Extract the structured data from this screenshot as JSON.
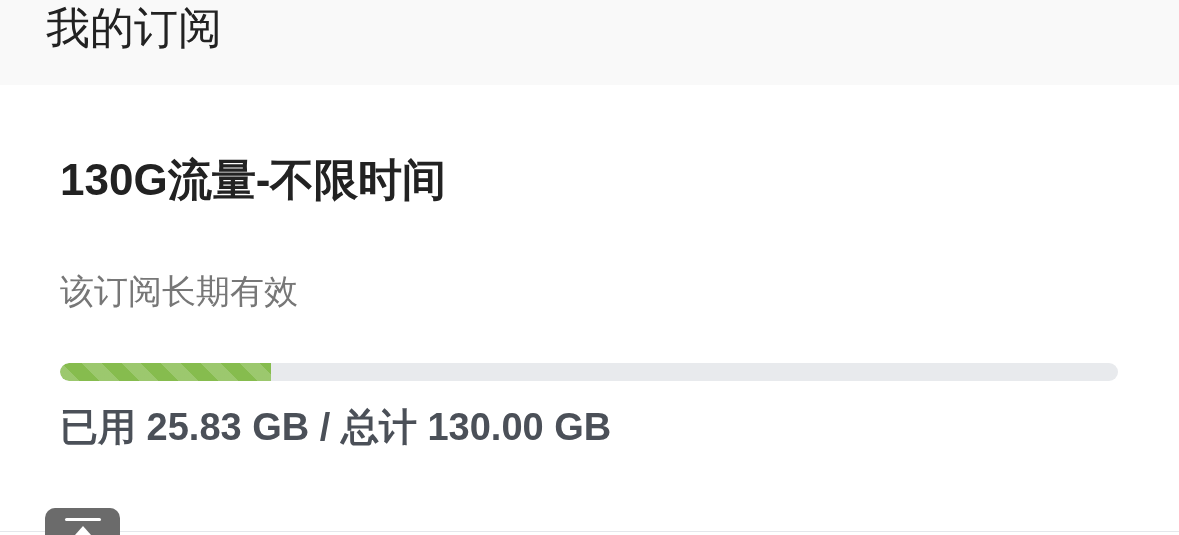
{
  "page": {
    "title": "我的订阅"
  },
  "subscription": {
    "name": "130G流量-不限时间",
    "validity": "该订阅长期有效",
    "level": 0.199,
    "usage": "已用 25.83 GB / 总计 130.00 GB"
  }
}
